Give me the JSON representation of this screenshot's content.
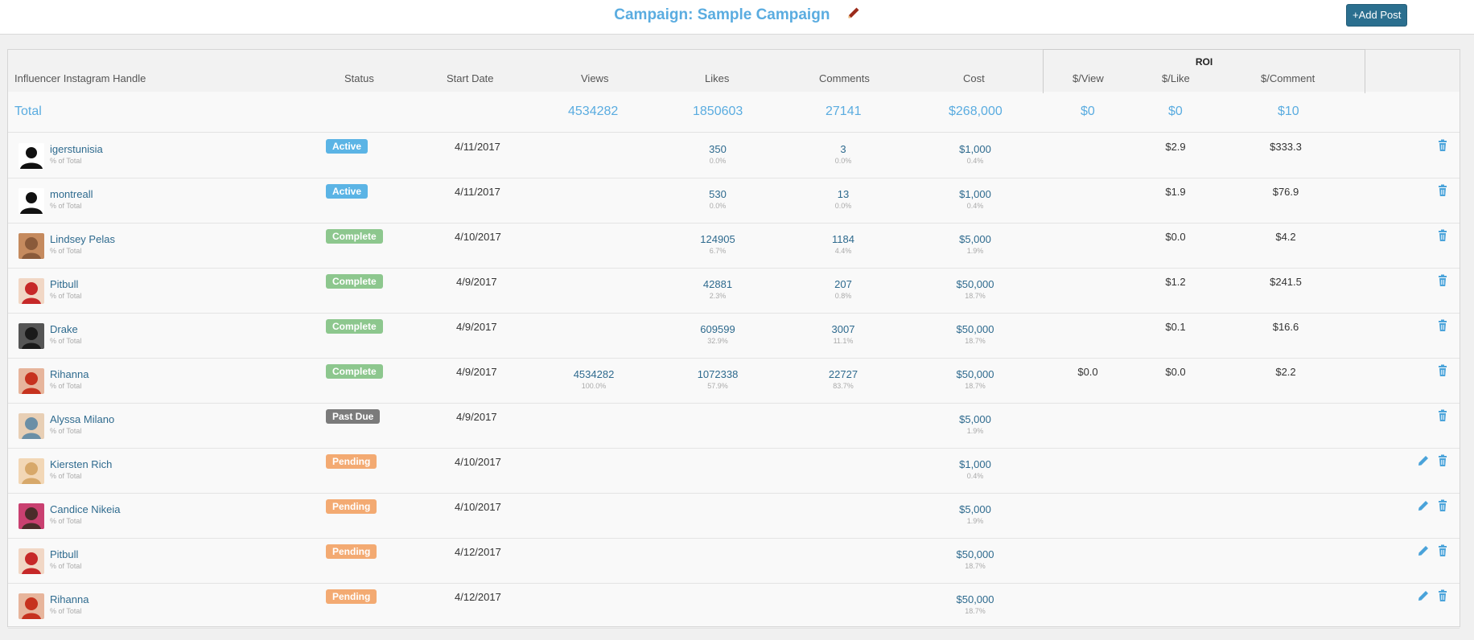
{
  "header": {
    "title": "Campaign: Sample Campaign",
    "add_post_label": "+Add Post"
  },
  "table": {
    "columns": {
      "handle": "Influencer Instagram Handle",
      "status": "Status",
      "start_date": "Start Date",
      "views": "Views",
      "likes": "Likes",
      "comments": "Comments",
      "cost": "Cost",
      "roi": "ROI",
      "per_view": "$/View",
      "per_like": "$/Like",
      "per_comment": "$/Comment"
    },
    "totals": {
      "label": "Total",
      "views": "4534282",
      "likes": "1850603",
      "comments": "27141",
      "cost": "$268,000",
      "per_view": "$0",
      "per_like": "$0",
      "per_comment": "$10"
    },
    "pct_of_total_label": "% of Total",
    "rows": [
      {
        "name": "igerstunisia",
        "status": "Active",
        "date": "4/11/2017",
        "views": "",
        "views_pct": "",
        "likes": "350",
        "likes_pct": "0.0%",
        "comments": "3",
        "comments_pct": "0.0%",
        "cost": "$1,000",
        "cost_pct": "0.4%",
        "per_view": "",
        "per_like": "$2.9",
        "per_comment": "$333.3",
        "editable": false
      },
      {
        "name": "montreall",
        "status": "Active",
        "date": "4/11/2017",
        "views": "",
        "views_pct": "",
        "likes": "530",
        "likes_pct": "0.0%",
        "comments": "13",
        "comments_pct": "0.0%",
        "cost": "$1,000",
        "cost_pct": "0.4%",
        "per_view": "",
        "per_like": "$1.9",
        "per_comment": "$76.9",
        "editable": false
      },
      {
        "name": "Lindsey Pelas",
        "status": "Complete",
        "date": "4/10/2017",
        "views": "",
        "views_pct": "",
        "likes": "124905",
        "likes_pct": "6.7%",
        "comments": "1184",
        "comments_pct": "4.4%",
        "cost": "$5,000",
        "cost_pct": "1.9%",
        "per_view": "",
        "per_like": "$0.0",
        "per_comment": "$4.2",
        "editable": false
      },
      {
        "name": "Pitbull",
        "status": "Complete",
        "date": "4/9/2017",
        "views": "",
        "views_pct": "",
        "likes": "42881",
        "likes_pct": "2.3%",
        "comments": "207",
        "comments_pct": "0.8%",
        "cost": "$50,000",
        "cost_pct": "18.7%",
        "per_view": "",
        "per_like": "$1.2",
        "per_comment": "$241.5",
        "editable": false
      },
      {
        "name": "Drake",
        "status": "Complete",
        "date": "4/9/2017",
        "views": "",
        "views_pct": "",
        "likes": "609599",
        "likes_pct": "32.9%",
        "comments": "3007",
        "comments_pct": "11.1%",
        "cost": "$50,000",
        "cost_pct": "18.7%",
        "per_view": "",
        "per_like": "$0.1",
        "per_comment": "$16.6",
        "editable": false
      },
      {
        "name": "Rihanna",
        "status": "Complete",
        "date": "4/9/2017",
        "views": "4534282",
        "views_pct": "100.0%",
        "likes": "1072338",
        "likes_pct": "57.9%",
        "comments": "22727",
        "comments_pct": "83.7%",
        "cost": "$50,000",
        "cost_pct": "18.7%",
        "per_view": "$0.0",
        "per_like": "$0.0",
        "per_comment": "$2.2",
        "editable": false
      },
      {
        "name": "Alyssa Milano",
        "status": "Past Due",
        "date": "4/9/2017",
        "views": "",
        "views_pct": "",
        "likes": "",
        "likes_pct": "",
        "comments": "",
        "comments_pct": "",
        "cost": "$5,000",
        "cost_pct": "1.9%",
        "per_view": "",
        "per_like": "",
        "per_comment": "",
        "editable": false
      },
      {
        "name": "Kiersten Rich",
        "status": "Pending",
        "date": "4/10/2017",
        "views": "",
        "views_pct": "",
        "likes": "",
        "likes_pct": "",
        "comments": "",
        "comments_pct": "",
        "cost": "$1,000",
        "cost_pct": "0.4%",
        "per_view": "",
        "per_like": "",
        "per_comment": "",
        "editable": true
      },
      {
        "name": "Candice Nikeia",
        "status": "Pending",
        "date": "4/10/2017",
        "views": "",
        "views_pct": "",
        "likes": "",
        "likes_pct": "",
        "comments": "",
        "comments_pct": "",
        "cost": "$5,000",
        "cost_pct": "1.9%",
        "per_view": "",
        "per_like": "",
        "per_comment": "",
        "editable": true
      },
      {
        "name": "Pitbull",
        "status": "Pending",
        "date": "4/12/2017",
        "views": "",
        "views_pct": "",
        "likes": "",
        "likes_pct": "",
        "comments": "",
        "comments_pct": "",
        "cost": "$50,000",
        "cost_pct": "18.7%",
        "per_view": "",
        "per_like": "",
        "per_comment": "",
        "editable": true
      },
      {
        "name": "Rihanna",
        "status": "Pending",
        "date": "4/12/2017",
        "views": "",
        "views_pct": "",
        "likes": "",
        "likes_pct": "",
        "comments": "",
        "comments_pct": "",
        "cost": "$50,000",
        "cost_pct": "18.7%",
        "per_view": "",
        "per_like": "",
        "per_comment": "",
        "editable": true
      }
    ]
  },
  "status_colors": {
    "Active": "#5bb4e5",
    "Complete": "#8dc78e",
    "Past Due": "#7b7b7b",
    "Pending": "#f3aa72"
  },
  "colors": {
    "accent": "#5aace0",
    "link": "#2e6a8e"
  }
}
